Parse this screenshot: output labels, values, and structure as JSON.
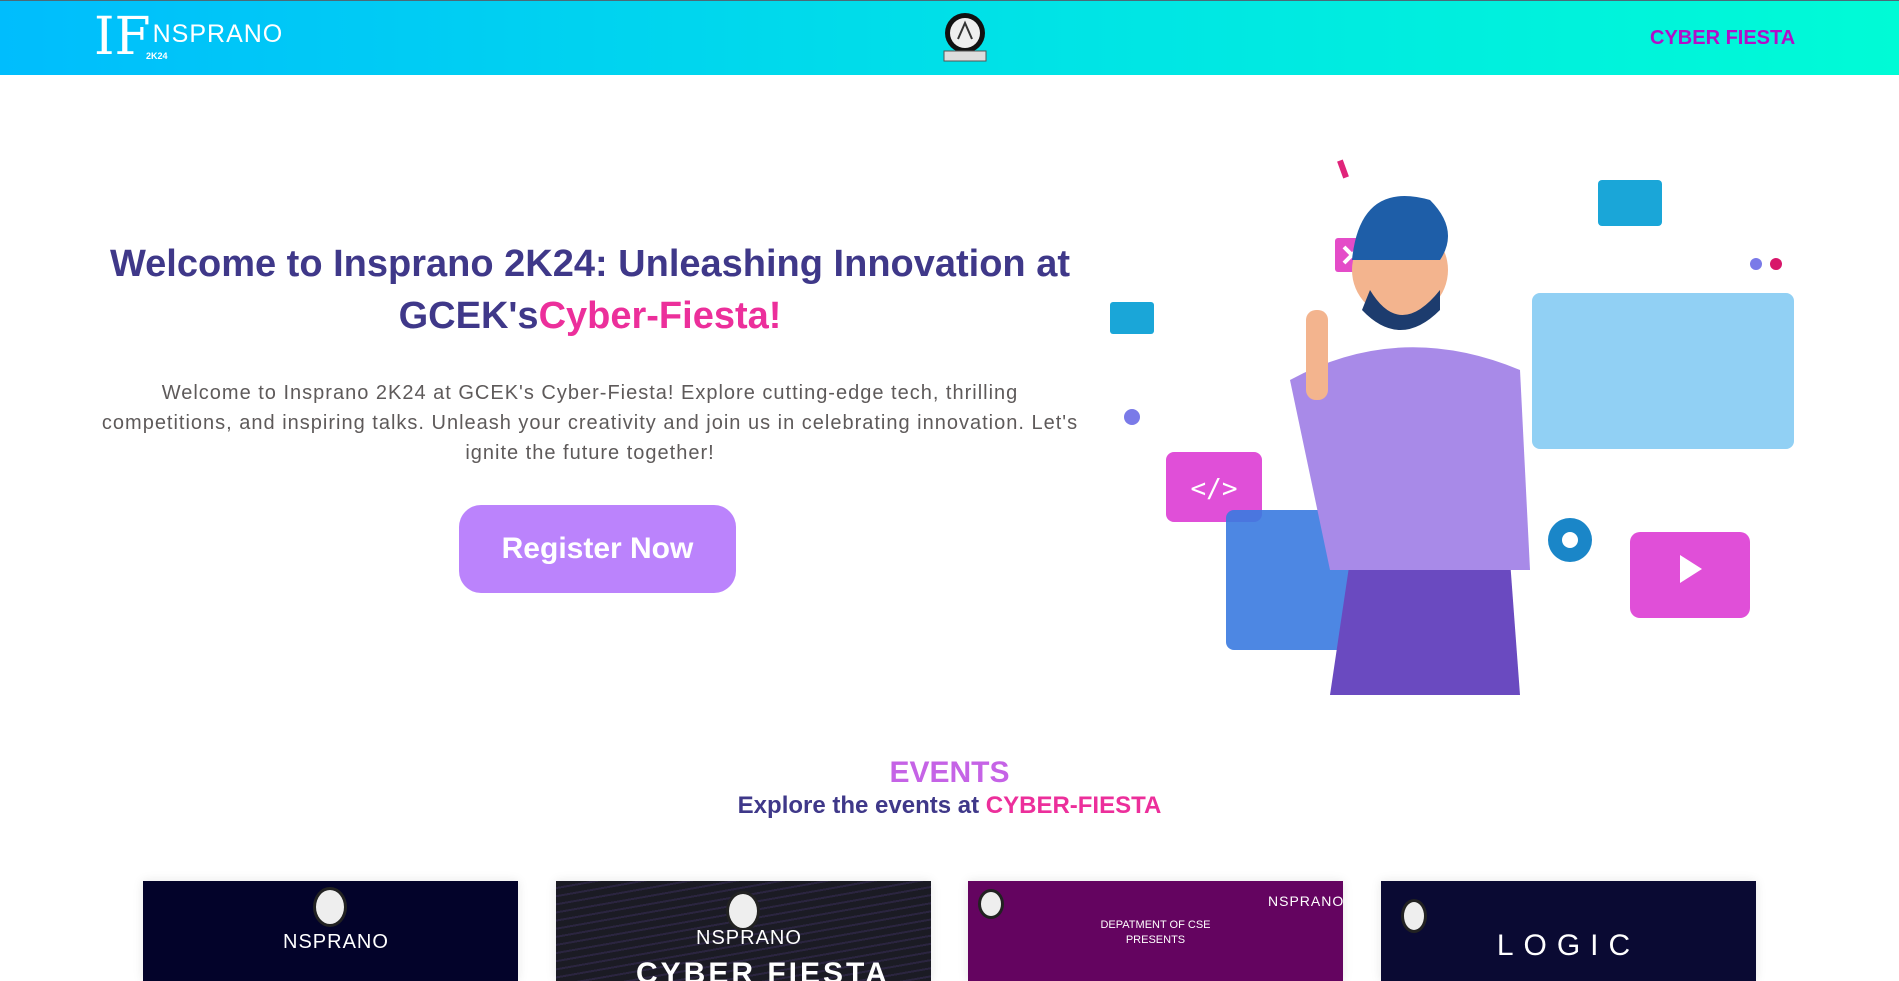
{
  "header": {
    "logo_mark": "IF",
    "logo_text": "NSPRANO",
    "logo_sub": "2K24",
    "nav_link": "CYBER FIESTA"
  },
  "hero": {
    "title_part1": "Welcome to Insprano 2K24: Unleashing Innovation at GCEK's",
    "title_part2": "Cyber-Fiesta!",
    "description": "Welcome to Insprano 2K24 at GCEK's Cyber-Fiesta! Explore cutting-edge tech, thrilling competitions, and inspiring talks. Unleash your creativity and join us in celebrating innovation. Let's ignite the future together!",
    "register_label": "Register Now"
  },
  "events": {
    "title": "EVENTS",
    "subtitle_part1": "Explore the events at ",
    "subtitle_part2": "CYBER-FIESTA",
    "cards": [
      {
        "text": "NSPRANO"
      },
      {
        "text": "NSPRANO",
        "heading": "CYBER FIESTA"
      },
      {
        "line1": "DEPATMENT OF CSE",
        "line2": "PRESENTS",
        "logo": "NSPRANO"
      },
      {
        "heading": "LOGIC"
      }
    ]
  },
  "colors": {
    "primary": "#3f3889",
    "accent": "#ec2f9b",
    "button": "#bb83fc",
    "nav": "#b10fc8"
  }
}
